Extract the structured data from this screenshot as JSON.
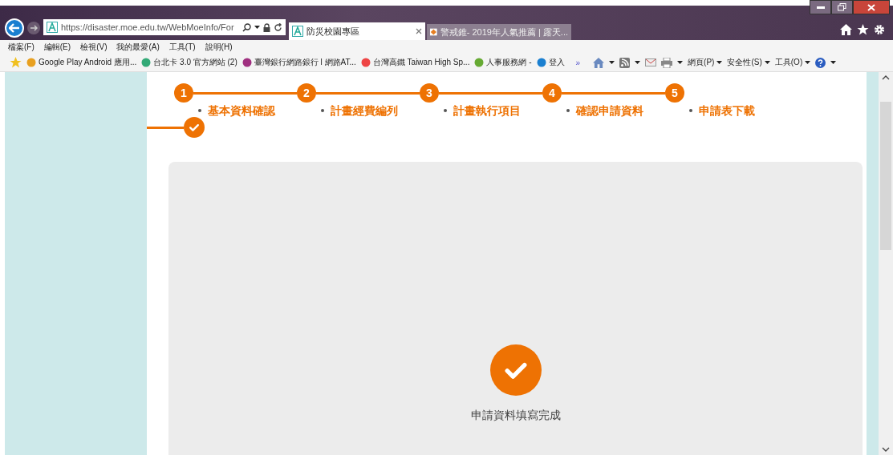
{
  "browser": {
    "address": "https://disaster.moe.edu.tw/WebMoeInfo/For",
    "tabs": [
      {
        "title": "防災校園專區",
        "selected": true
      },
      {
        "title": "警戒錐- 2019年人氣推薦 | 露天...",
        "selected": false
      }
    ],
    "menu": [
      "檔案(F)",
      "編輯(E)",
      "檢視(V)",
      "我的最愛(A)",
      "工具(T)",
      "說明(H)"
    ],
    "favorites": [
      "Google Play Android 應用...",
      "台北卡 3.0 官方網站 (2)",
      "臺灣銀行網路銀行 l 網路AT...",
      "台灣高鐵 Taiwan High Sp...",
      "人事服務網 -",
      "登入"
    ],
    "overflow": "»",
    "commands": [
      "網頁(P)",
      "安全性(S)",
      "工具(O)"
    ]
  },
  "steps": [
    {
      "number": "1",
      "label": "基本資料確認"
    },
    {
      "number": "2",
      "label": "計畫經費編列"
    },
    {
      "number": "3",
      "label": "計畫執行項目"
    },
    {
      "number": "4",
      "label": "確認申請資料"
    },
    {
      "number": "5",
      "label": "申請表下載"
    }
  ],
  "completed_message": "申請資料填寫完成"
}
